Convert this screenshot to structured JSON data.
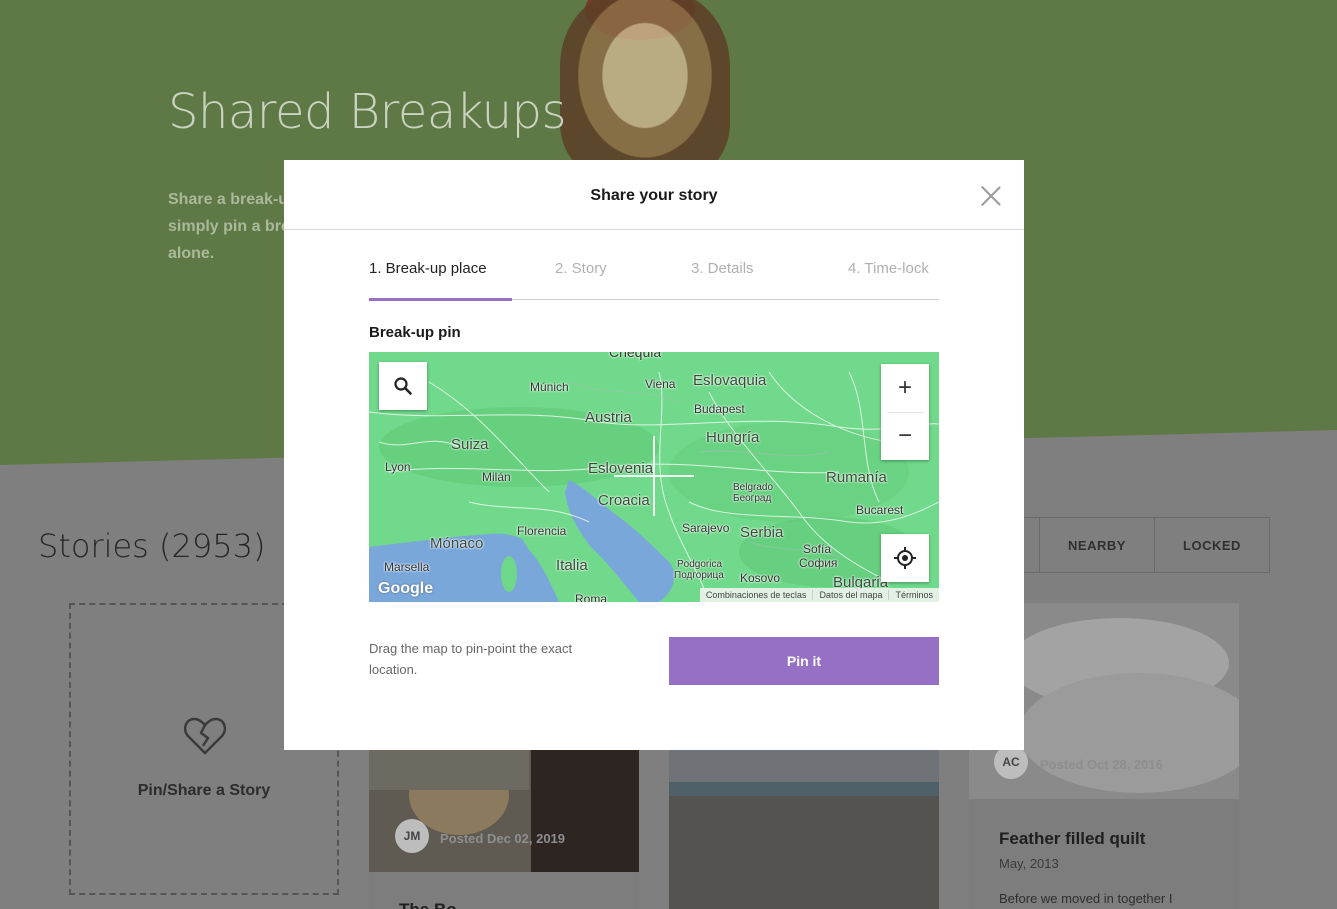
{
  "hero": {
    "title": "Shared Breakups",
    "text_lines": [
      "Share a break-u",
      "simply pin a bre",
      "alone."
    ]
  },
  "stories": {
    "title": "Stories (2953)",
    "filters": [
      "",
      "NEARBY",
      "LOCKED"
    ]
  },
  "pin_card": {
    "label": "Pin/Share a Story",
    "icon": "broken-heart-icon"
  },
  "cards": [
    {
      "initials": "JM",
      "posted": "Posted Dec 02, 2019",
      "title": "The Bo..."
    },
    {
      "initials": "",
      "posted": "",
      "title": ""
    },
    {
      "initials": "AC",
      "posted": "Posted Oct 28, 2016",
      "title": "Feather filled quilt",
      "date": "May, 2013",
      "excerpt": "Before we moved in together I"
    }
  ],
  "modal": {
    "title": "Share your story",
    "steps": [
      "1. Break-up place",
      "2. Story",
      "3. Details",
      "4. Time-lock"
    ],
    "active_step": 0,
    "section_label": "Break-up pin",
    "hint": "Drag the map to pin-point the exact location.",
    "pin_button": "Pin it",
    "accent_color": "#9670c4"
  },
  "map": {
    "labels": {
      "chequia": "Chequia",
      "munich": "Múnich",
      "viena": "Viena",
      "eslovaquia": "Eslovaquia",
      "budapest": "Budapest",
      "austria": "Austria",
      "hungria": "Hungría",
      "suiza": "Suiza",
      "lyon": "Lyon",
      "milan": "Milán",
      "eslovenia": "Eslovenia",
      "croacia": "Croacia",
      "belgrado": "Belgrado",
      "beograd": "Београд",
      "rumania": "Rumanía",
      "bucarest": "Bucarest",
      "florencia": "Florencia",
      "sarajevo": "Sarajevo",
      "serbia": "Serbia",
      "monaco": "Mónaco",
      "sofia": "Sofía",
      "sofia_cyr": "София",
      "marsella": "Marsella",
      "italia": "Italia",
      "podgorica": "Podgorica",
      "podgorica_cyr": "Подгорица",
      "kosovo": "Kosovo",
      "bulgaria": "Bulgaria",
      "roma": "Roma"
    },
    "google": "Google",
    "footer": [
      "Combinaciones de teclas",
      "Datos del mapa",
      "Términos"
    ],
    "zoom_in": "+",
    "zoom_out": "−"
  }
}
